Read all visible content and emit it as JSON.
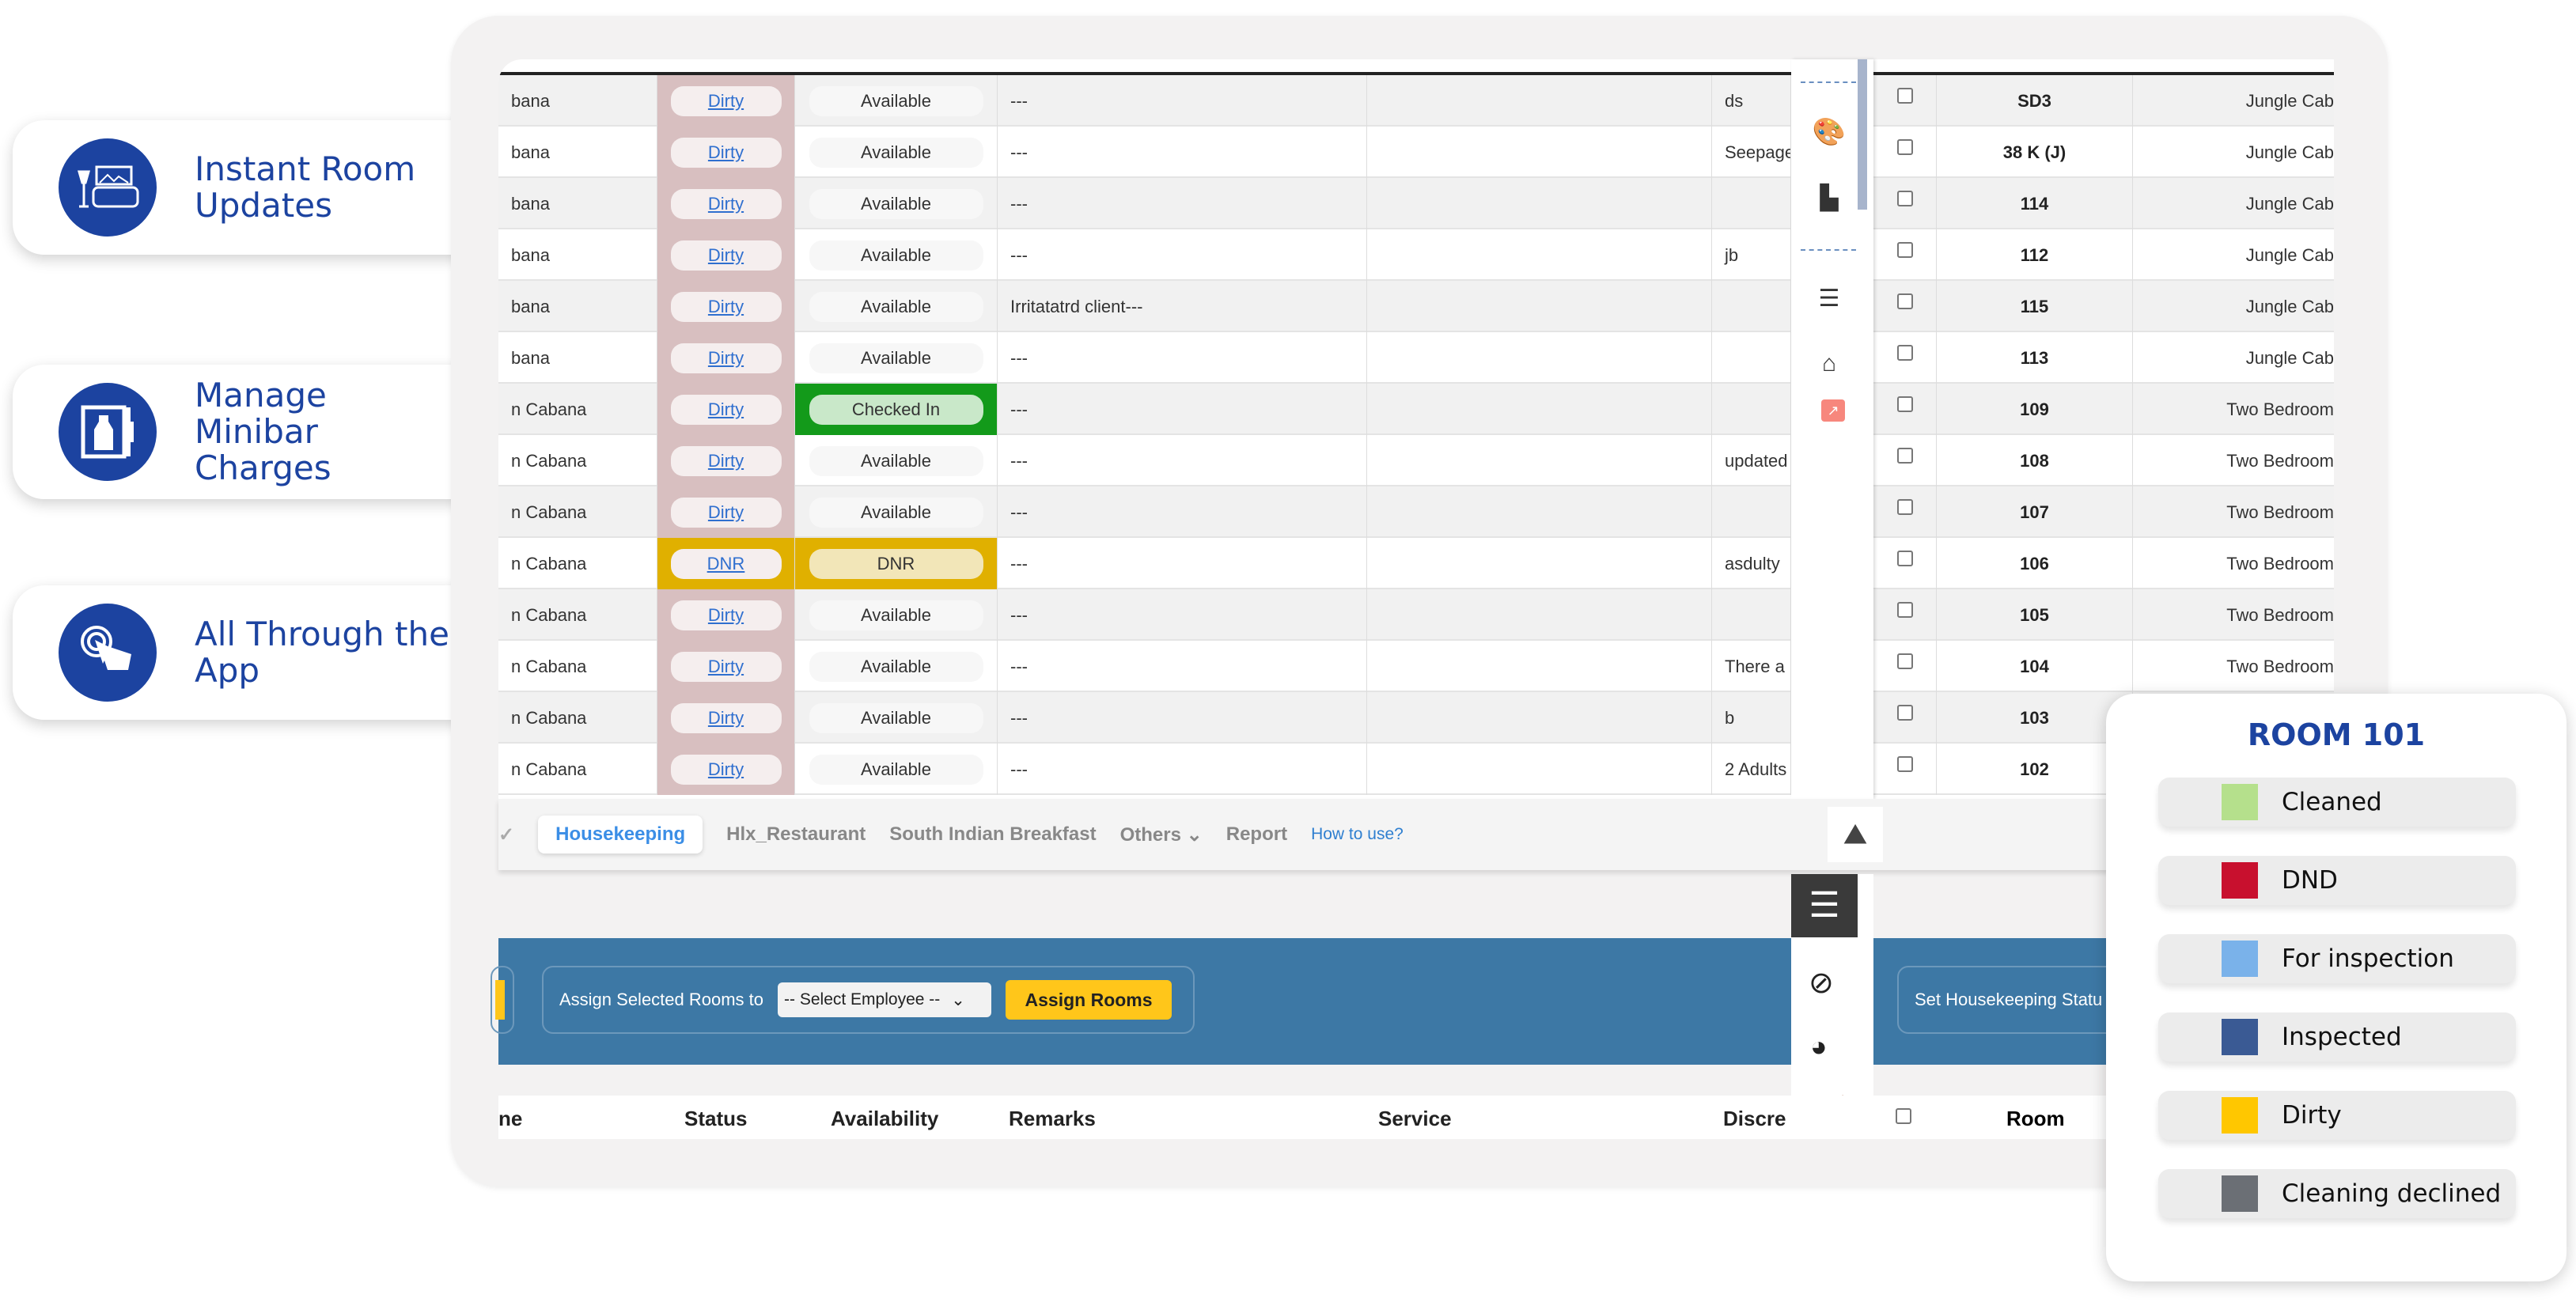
{
  "features": [
    {
      "label": "Instant Room Updates",
      "icon": "room-lamp-bed-icon"
    },
    {
      "label": "Manage Minibar Charges",
      "icon": "minibar-fridge-icon"
    },
    {
      "label": "All Through the App",
      "icon": "touch-hand-icon"
    }
  ],
  "table": {
    "rows": [
      {
        "name": "bana",
        "status": "Dirty",
        "availability": "Available",
        "remarks": "---",
        "service": "",
        "discrepancy": "ds",
        "room": "SD3",
        "type": "Jungle Cab"
      },
      {
        "name": "bana",
        "status": "Dirty",
        "availability": "Available",
        "remarks": "---",
        "service": "",
        "discrepancy": "Seepage",
        "room": "38 K (J)",
        "type": "Jungle Cab"
      },
      {
        "name": "bana",
        "status": "Dirty",
        "availability": "Available",
        "remarks": "---",
        "service": "",
        "discrepancy": "",
        "room": "114",
        "type": "Jungle Cab"
      },
      {
        "name": "bana",
        "status": "Dirty",
        "availability": "Available",
        "remarks": "---",
        "service": "",
        "discrepancy": "jb",
        "room": "112",
        "type": "Jungle Cab"
      },
      {
        "name": "bana",
        "status": "Dirty",
        "availability": "Available",
        "remarks": "Irritatatrd client---",
        "service": "",
        "discrepancy": "",
        "room": "115",
        "type": "Jungle Cab"
      },
      {
        "name": "bana",
        "status": "Dirty",
        "availability": "Available",
        "remarks": "---",
        "service": "",
        "discrepancy": "",
        "room": "113",
        "type": "Jungle Cab"
      },
      {
        "name": "n Cabana",
        "status": "Dirty",
        "availability": "Checked In",
        "remarks": "---",
        "service": "",
        "discrepancy": "",
        "room": "109",
        "type": "Two Bedroom"
      },
      {
        "name": "n Cabana",
        "status": "Dirty",
        "availability": "Available",
        "remarks": "---",
        "service": "",
        "discrepancy": "updated",
        "room": "108",
        "type": "Two Bedroom"
      },
      {
        "name": "n Cabana",
        "status": "Dirty",
        "availability": "Available",
        "remarks": "---",
        "service": "",
        "discrepancy": "",
        "room": "107",
        "type": "Two Bedroom"
      },
      {
        "name": "n Cabana",
        "status": "DNR",
        "availability": "DNR",
        "remarks": "---",
        "service": "",
        "discrepancy": "asdulty",
        "room": "106",
        "type": "Two Bedroom"
      },
      {
        "name": "n Cabana",
        "status": "Dirty",
        "availability": "Available",
        "remarks": "---",
        "service": "",
        "discrepancy": "",
        "room": "105",
        "type": "Two Bedroom"
      },
      {
        "name": "n Cabana",
        "status": "Dirty",
        "availability": "Available",
        "remarks": "---",
        "service": "",
        "discrepancy": "There a",
        "room": "104",
        "type": "Two Bedroom"
      },
      {
        "name": "n Cabana",
        "status": "Dirty",
        "availability": "Available",
        "remarks": "---",
        "service": "",
        "discrepancy": "b",
        "room": "103",
        "type": "Two Bedroom"
      },
      {
        "name": "n Cabana",
        "status": "Dirty",
        "availability": "Available",
        "remarks": "---",
        "service": "",
        "discrepancy": "2 Adults",
        "room": "102",
        "type": "Two Bedroom"
      }
    ],
    "headers": {
      "name": "ne",
      "status": "Status",
      "availability": "Availability",
      "remarks": "Remarks",
      "service": "Service",
      "discrepancy": "Discre",
      "room": "Room"
    }
  },
  "side_icons": [
    "palette-icon",
    "swatches-icon",
    "list-icon",
    "house-check-icon",
    "external-link-icon"
  ],
  "tabs": {
    "check": "✓",
    "items": [
      "Housekeeping",
      "Hlx_Restaurant",
      "South Indian Breakfast",
      "Others",
      "Report"
    ],
    "active": "Housekeeping",
    "help": "How to use?"
  },
  "toolbar": {
    "assign_label": "Assign Selected Rooms to",
    "employee_select": "-- Select Employee --",
    "assign_button": "Assign Rooms",
    "set_status": "Set Housekeeping Statu"
  },
  "legend": {
    "title": "ROOM 101",
    "items": [
      {
        "label": "Cleaned",
        "color": "#b5e08c"
      },
      {
        "label": "DND",
        "color": "#c8102e"
      },
      {
        "label": "For inspection",
        "color": "#7ab2ea"
      },
      {
        "label": "Inspected",
        "color": "#3a5a94"
      },
      {
        "label": "Dirty",
        "color": "#ffc700"
      },
      {
        "label": "Cleaning declined",
        "color": "#6b6f75"
      }
    ]
  }
}
